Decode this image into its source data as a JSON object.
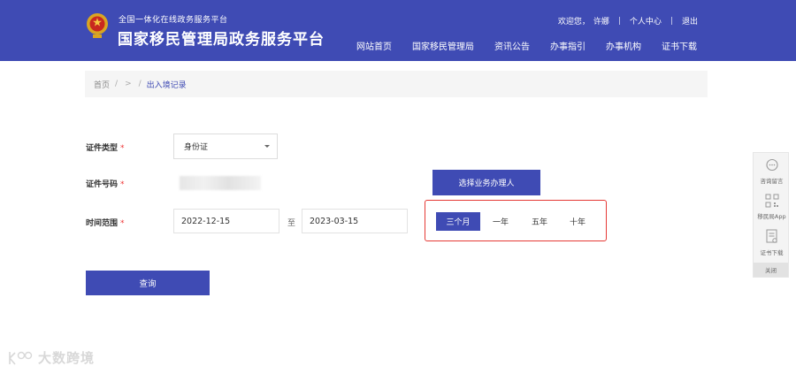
{
  "header": {
    "subtitle": "全国一体化在线政务服务平台",
    "title": "国家移民管理局政务服务平台",
    "user": {
      "greeting": "欢迎您，",
      "name": "许娜",
      "profile": "个人中心",
      "logout": "退出"
    },
    "nav": [
      "网站首页",
      "国家移民管理局",
      "资讯公告",
      "办事指引",
      "办事机构",
      "证书下载"
    ]
  },
  "breadcrumb": {
    "home": "首页",
    "sep1": "/",
    "sep2": ">",
    "sep3": "/",
    "current": "出入境记录"
  },
  "form": {
    "doc_type_label": "证件类型",
    "doc_type_value": "身份证",
    "doc_number_label": "证件号码",
    "select_agent": "选择业务办理人",
    "time_range_label": "时间范围",
    "start_date": "2022-12-15",
    "to": "至",
    "end_date": "2023-03-15",
    "required_mark": "*",
    "ranges": [
      "三个月",
      "一年",
      "五年",
      "十年"
    ],
    "active_range": "三个月",
    "query": "查询"
  },
  "side_panel": {
    "consult": "咨询留言",
    "app": "移民局App",
    "cert": "证书下载",
    "close": "关闭"
  },
  "watermark": "大数跨境",
  "colors": {
    "primary": "#3f4bb4",
    "highlight": "#e53935"
  }
}
